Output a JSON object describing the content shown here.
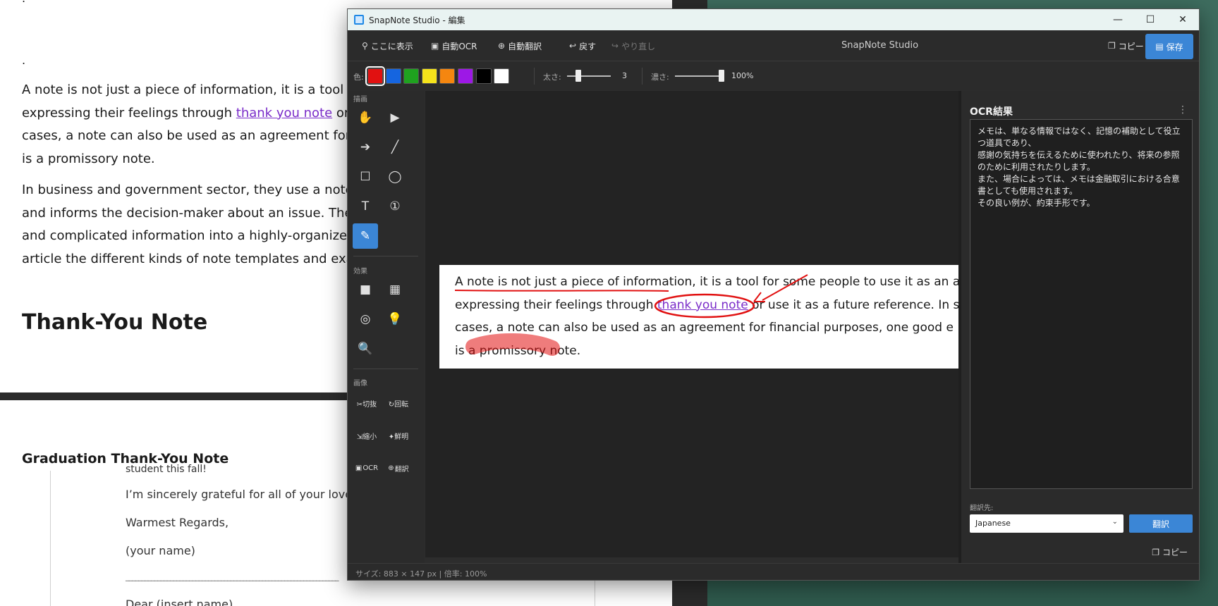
{
  "background_document": {
    "dot1": ".",
    "dot2": ".",
    "para1": {
      "l1": "A note is not just a piece of information, it is a tool for",
      "l2_pre": "expressing their feelings through ",
      "l2_link": "thank you note",
      "l2_post": " or us",
      "l3": "cases, a note can also be used as an agreement for fi",
      "l4": "is a promissory note."
    },
    "para2": {
      "l1": "In business and government sector, they use a note, s",
      "l2": "and informs the decision-maker about an issue. They",
      "l3": "and complicated information into a highly-organized p",
      "l4": "article the different kinds of note templates and exam"
    },
    "heading_thank_you": "Thank-You Note",
    "heading_graduation": "Graduation Thank-You Note",
    "letter_lines": {
      "student": "student this fall!",
      "grateful": "I’m sincerely grateful for all of your love a",
      "regards": "Warmest Regards,",
      "name": "(your name)",
      "rule": "___________________________________________________________________",
      "dear": "Dear (insert name)"
    }
  },
  "window": {
    "title": "SnapNote Studio - 編集",
    "controls": {
      "minimize": "—",
      "maximize": "☐",
      "close": "✕"
    }
  },
  "toolbar": {
    "pin_label": "ここに表示",
    "auto_ocr_label": "自動OCR",
    "auto_translate_label": "自動翻訳",
    "undo_label": "戻す",
    "redo_label": "やり直し",
    "app_name": "SnapNote Studio",
    "copy_label": "コピー",
    "save_label": "保存"
  },
  "style_bar": {
    "color_label": "色:",
    "colors": [
      "#e11111",
      "#1565e0",
      "#1fa21f",
      "#f5e31b",
      "#f5860f",
      "#9d18e6",
      "#000000",
      "#ffffff"
    ],
    "selected_color_index": 0,
    "thickness_label": "太さ:",
    "thickness_value": "3",
    "thickness_level": 0.2,
    "opacity_label": "濃さ:",
    "opacity_value": "100%",
    "opacity_level": 1.0
  },
  "tools": {
    "draw_section": "描画",
    "effects_section": "効果",
    "image_section": "画像",
    "active_tool": "pen",
    "image_tools": {
      "crop": "✂切抜",
      "rotate": "↻回転",
      "shrink": "⇲縮小",
      "sharpen": "✦鮮明",
      "ocr": "OCR",
      "translate": "翻訳"
    }
  },
  "canvas": {
    "line1_pre": "A note is not just a piece of information, it is a tool for some people to use it as an a",
    "line2_pre": "expressing their feelings through ",
    "line2_link": "thank you note",
    "line2_post": " or use it as a future reference. In s",
    "line3": "cases, a note can also be used as an agreement for financial purposes, one good e",
    "line4": "is a promissory note.",
    "annotation_color": "#e11111"
  },
  "ocr_panel": {
    "title": "OCR結果",
    "more": "⋮",
    "lines": [
      "メモは、単なる情報ではなく、記憶の補助として役立つ道具であり、",
      "感謝の気持ちを伝えるために使われたり、将来の参照のために利用されたりします。",
      "また、場合によっては、メモは金融取引における合意書としても使用されます。",
      "その良い例が、約束手形です。"
    ],
    "translate_to_label": "翻訳先:",
    "language": "Japanese",
    "translate_button": "翻訳",
    "copy_label": "コピー"
  },
  "status": {
    "text": "サイズ: 883 × 147 px | 倍率: 100%"
  }
}
